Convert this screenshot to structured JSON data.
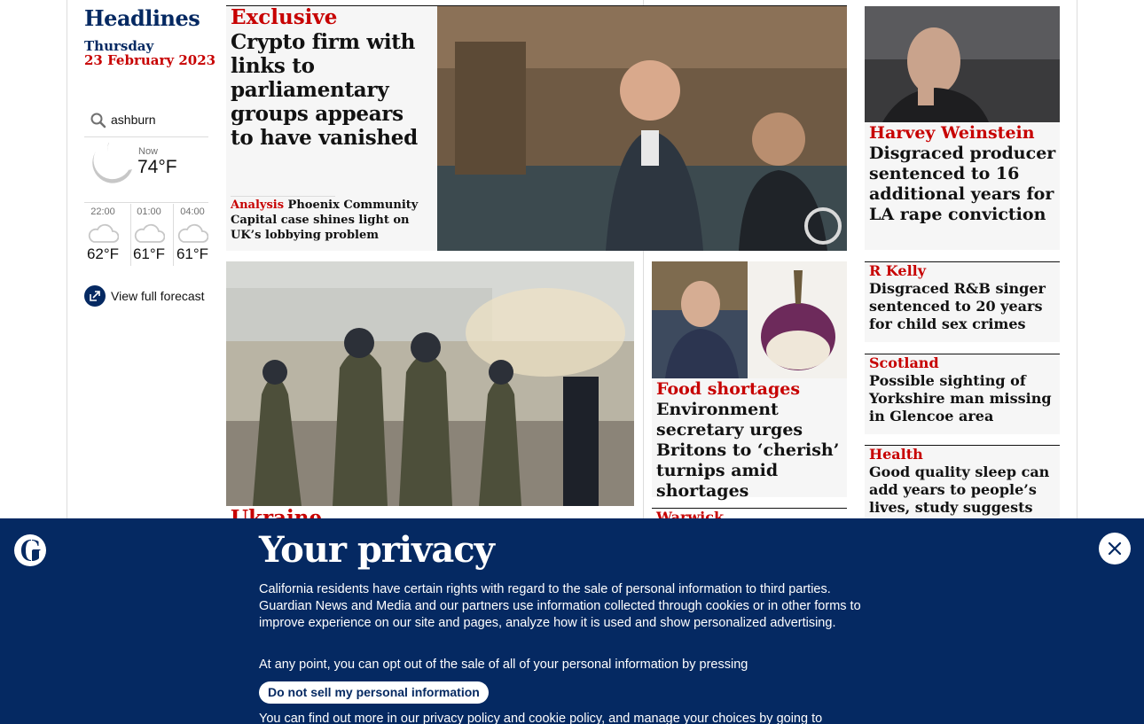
{
  "sidebar": {
    "title": "Headlines",
    "weekday": "Thursday",
    "date": "23 February 2023",
    "search_value": "ashburn",
    "weather": {
      "now_label": "Now",
      "now_temp": "74°F",
      "forecast": [
        {
          "time": "22:00",
          "temp": "62°F"
        },
        {
          "time": "01:00",
          "temp": "61°F"
        },
        {
          "time": "04:00",
          "temp": "61°F"
        }
      ],
      "full_forecast_label": "View full forecast"
    }
  },
  "lead": {
    "kicker": "Exclusive",
    "headline": "Crypto firm with links to parliamentary groups appears to have vanished",
    "sub_kicker": "Analysis",
    "sub_text": " Phoenix Community Capital case shines light on UK’s lobbying problem"
  },
  "stories": {
    "weinstein": {
      "kicker": "Harvey Weinstein",
      "headline": "Disgraced producer sentenced to 16 additional years for LA rape conviction"
    },
    "rkelly": {
      "kicker": "R Kelly",
      "headline": "Disgraced R&B singer sentenced to 20 years for child sex crimes"
    },
    "scotland": {
      "kicker": "Scotland",
      "headline": "Possible sighting of Yorkshire man missing in Glencoe area"
    },
    "health": {
      "kicker": "Health",
      "headline": "Good quality sleep can add years to people’s lives, study suggests"
    },
    "food": {
      "kicker": "Food shortages",
      "headline": "Environment secretary urges Britons to ‘cherish’ turnips amid shortages"
    },
    "ukraine": {
      "kicker": "Ukraine"
    },
    "warwick": {
      "kicker": "Warwick"
    }
  },
  "privacy": {
    "title": "Your privacy",
    "body": "California residents have certain rights with regard to the sale of personal information to third parties. Guardian News and Media and our partners use information collected through cookies or in other forms to improve experience on our site and pages, analyze how it is used and show personalized advertising.",
    "line2": "At any point, you can opt out of the sale of all of your personal information by pressing",
    "button": "Do not sell my personal information",
    "more_prefix": "You can find out more in our ",
    "privacy_link": "privacy policy",
    "and": " and ",
    "cookie_link": "cookie policy",
    "more_suffix": ", and manage your choices by going to"
  },
  "colors": {
    "brand_blue": "#052962",
    "news_red": "#c70000",
    "card_grey": "#f6f6f6"
  },
  "icons": [
    "search-icon",
    "moon-icon",
    "cloud-icon",
    "external-link-icon",
    "guardian-logo-icon",
    "close-icon"
  ]
}
